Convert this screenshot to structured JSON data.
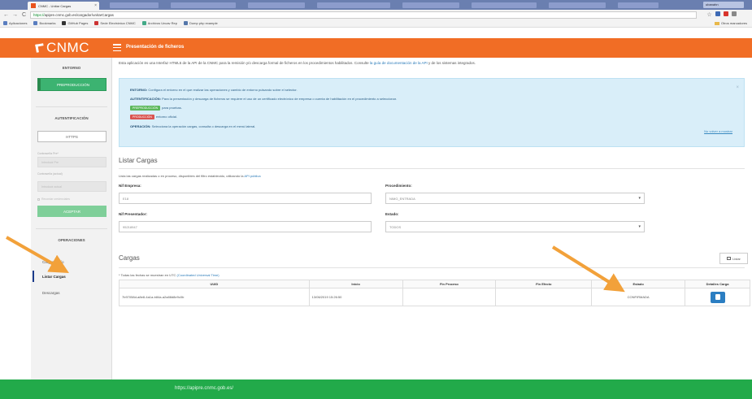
{
  "browser": {
    "tab_title": "CNMC - Unitar Cargas",
    "tab_close": "×",
    "url_scheme": "https://",
    "url_host": "apipre.cnmc.gob.es",
    "url_path": "/cargador/unitarCargas",
    "nav_back": "←",
    "nav_forward": "→",
    "nav_reload": "C",
    "star": "☆",
    "user_badge": "ubanahn",
    "bookmarks": [
      "Aplicaciones",
      "Bookmarks",
      "GitHub Pages",
      "Sede Electrónica CNMC",
      "Archivos Uncav Rep",
      "Dump php example"
    ],
    "other_bookmarks": "Otros marcadores"
  },
  "header": {
    "logo": "CNMC",
    "title": "Presentación de ficheros"
  },
  "sidebar": {
    "env_title": "ENTORNO",
    "env_button": "PREPRODUCCIÓN",
    "auth_title": "AUTENTIFICACIÓN",
    "auth_mode": "HTTPS",
    "user_label": "Contraseña Pre*",
    "user_placeholder": "Introducir Pre",
    "pass_label": "Contraseña (actual)",
    "pass_placeholder": "Introducir actual",
    "remember_label": "Recordar credenciales",
    "accept_button": "ACEPTAR",
    "ops_title": "OPERACIONES",
    "nav_items": [
      "Cargar Envío",
      "Listar Cargas",
      "Descargas"
    ]
  },
  "main": {
    "intro_text": "Esta aplicación es una Interfaz HTML5 de la API de la CNMC para la remisión y/o descarga formal de ficheros en los procedimientos habilitados. Consulte",
    "intro_link": "la guía de documentación de la API",
    "intro_tail": "y de los sistemas integrados.",
    "info": {
      "entorno_label": "ENTORNO:",
      "entorno_text": "Configura el entorno en el que realizar las operaciones y cambio de entorno pulsando sobre el selector.",
      "auth_label": "AUTENTIFICACIÓN:",
      "auth_text": "Para la presentación y descarga de ficheros se requiere el uso de un certificado electrónico de empresa o cuenta de habilitación en el procedimiento a seleccionar.",
      "pre_badge": "PREPRODUCCIÓN",
      "pre_text": "para pruebas.",
      "pro_badge": "PRODUCCIÓN",
      "pro_text": "entorno oficial.",
      "op_label": "OPERACIÓN:",
      "op_text": "Selecciona la operación cargas, consulta o descarga en el menú lateral.",
      "hide_link": "No volver a mostrar",
      "close": "×"
    },
    "form_title": "Listar Cargas",
    "help_text": "Lista las cargas realizadas o en proceso, disponibles del filtro establecido, utilizando la",
    "help_link": "API pública",
    "nif_empresa_label": "Nif Empresa:",
    "nif_empresa_value": "E18",
    "procedimiento_label": "Procedimiento:",
    "procedimiento_value": "NIMG_ENTRADA",
    "nif_presentador_label": "Nif Presentador:",
    "nif_presentador_value": "95218947",
    "estado_label": "Estado:",
    "estado_value": "TODOS",
    "select_caret": "▾"
  },
  "cargas": {
    "title": "Cargas",
    "export_label": "Listar",
    "note": "* Todas las fechas se muestran en UTC",
    "note_link": "(Coordinated Universal Time)",
    "columns": [
      "UUID",
      "Inicio",
      "Fin Proceso",
      "Fin Efecto",
      "Estado",
      "Detalles Carga"
    ],
    "rows": [
      {
        "uuid": "7b97058d-a8e8-4a1a-b84a-a2a88d8e9c0b",
        "inicio": "13/06/2019 15:26:50",
        "fin_proceso": "",
        "fin_efecto": "",
        "estado": "CONFIRMADA"
      }
    ]
  },
  "footer": {
    "url": "https://apipre.cnmc.gob.es/"
  },
  "colors": {
    "brand_orange": "#f16d25",
    "footer_green": "#22aa4a",
    "env_green": "#3cb371",
    "annotation_arrow": "#f2a13a"
  }
}
